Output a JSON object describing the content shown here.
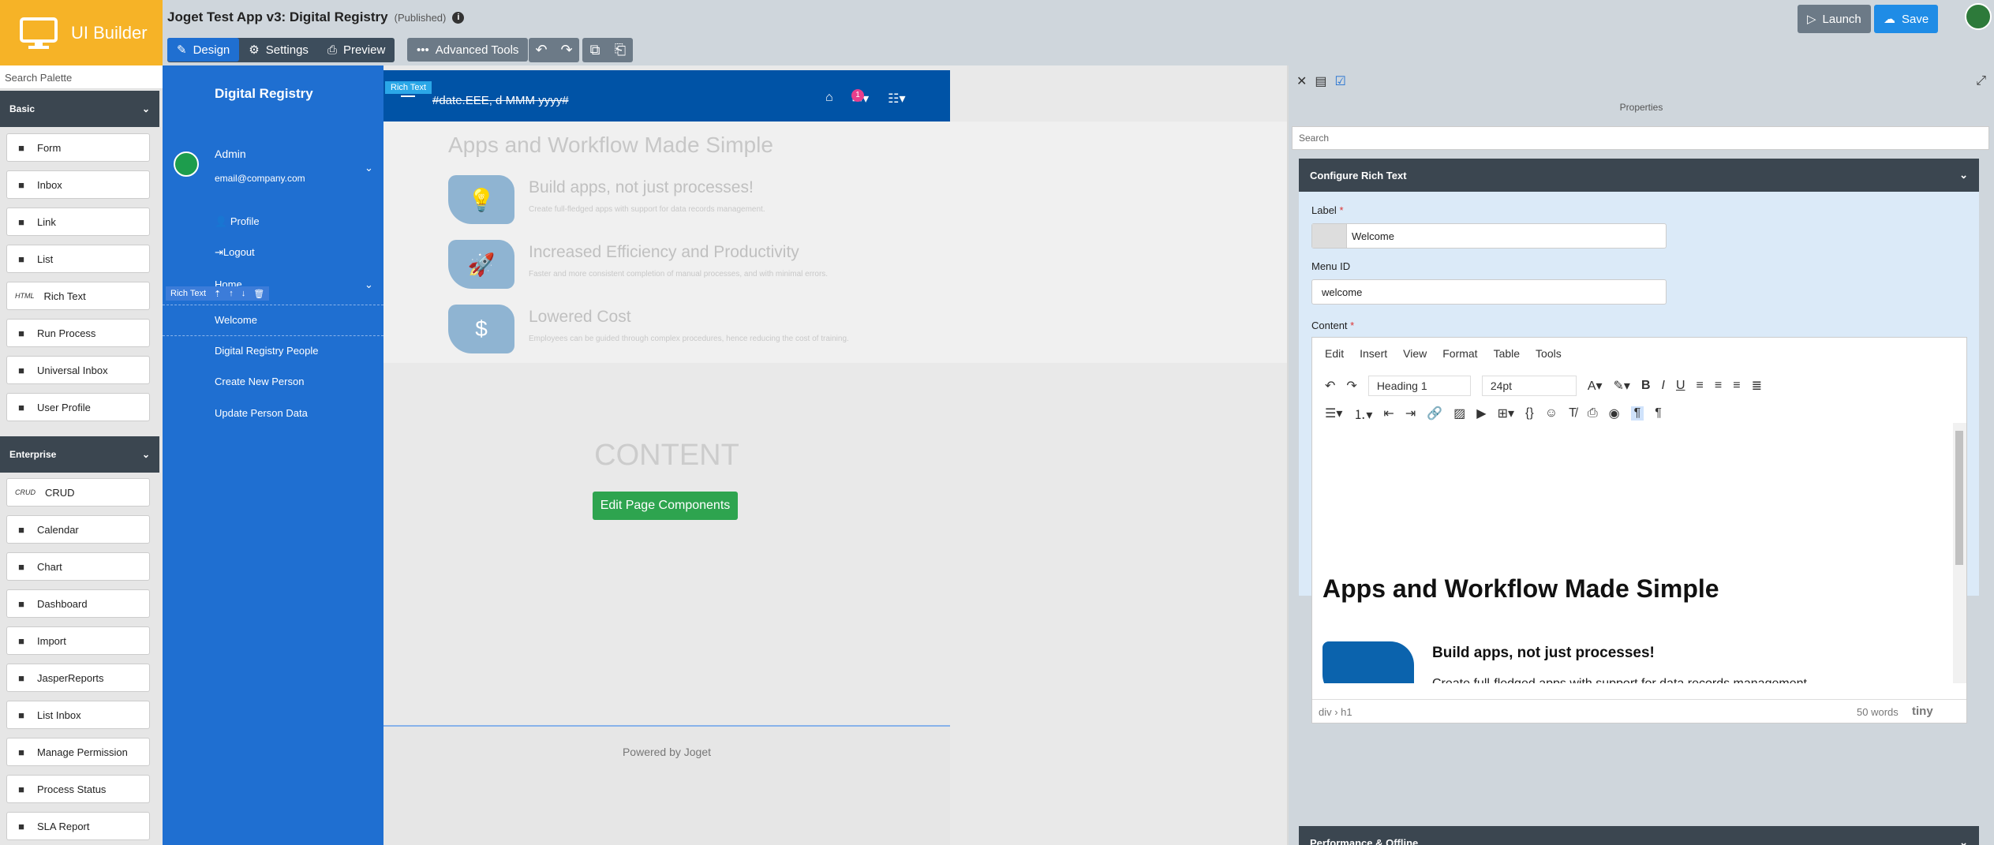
{
  "app": {
    "builder_name": "UI Builder",
    "title": "Joget Test App v3: Digital Registry",
    "status": "(Published)"
  },
  "toolbar": {
    "tabs": [
      "Design",
      "Settings",
      "Preview"
    ],
    "advanced_tools": "Advanced Tools",
    "launch": "Launch",
    "save": "Save"
  },
  "palette": {
    "search_placeholder": "Search Palette",
    "groups": [
      {
        "label": "Basic",
        "items": [
          {
            "label": "Form",
            "icon": "form-icon"
          },
          {
            "label": "Inbox",
            "icon": "inbox-icon"
          },
          {
            "label": "Link",
            "icon": "link-icon"
          },
          {
            "label": "List",
            "icon": "list-icon"
          },
          {
            "label": "Rich Text",
            "icon": "html-icon",
            "icon_text": "HTML"
          },
          {
            "label": "Run Process",
            "icon": "play-icon"
          },
          {
            "label": "Universal Inbox",
            "icon": "inbox-icon"
          },
          {
            "label": "User Profile",
            "icon": "user-edit-icon"
          }
        ]
      },
      {
        "label": "Enterprise",
        "items": [
          {
            "label": "CRUD",
            "icon": "crud-icon",
            "icon_text": "CRUD"
          },
          {
            "label": "Calendar",
            "icon": "calendar-icon"
          },
          {
            "label": "Chart",
            "icon": "chart-icon"
          },
          {
            "label": "Dashboard",
            "icon": "dashboard-icon"
          },
          {
            "label": "Import",
            "icon": "import-icon"
          },
          {
            "label": "JasperReports",
            "icon": "report-icon"
          },
          {
            "label": "List Inbox",
            "icon": "inbox-icon"
          },
          {
            "label": "Manage Permission",
            "icon": "users-icon"
          },
          {
            "label": "Process Status",
            "icon": "status-icon"
          },
          {
            "label": "SLA Report",
            "icon": "report-icon"
          }
        ]
      }
    ]
  },
  "canvas": {
    "nav": {
      "brand": "Digital Registry",
      "user_name": "Admin",
      "user_email": "email@company.com",
      "profile": "Profile",
      "logout": "Logout",
      "home": "Home",
      "element_bar_label": "Rich Text",
      "menu_items": [
        "Welcome",
        "Digital Registry People",
        "Create New Person",
        "Update Person Data"
      ]
    },
    "header": {
      "selected_label": "Rich Text",
      "date_format": "#date.EEE, d MMM yyyy#",
      "badge_count": "1"
    },
    "hero": {
      "title": "Apps and Workflow Made Simple",
      "features": [
        {
          "title": "Build apps, not just processes!",
          "desc": "Create full-fledged apps with support for data records management.",
          "icon": "lightbulb-icon"
        },
        {
          "title": "Increased Efficiency and Productivity",
          "desc": "Faster and more consistent completion of manual processes, and with minimal errors.",
          "icon": "rocket-icon"
        },
        {
          "title": "Lowered Cost",
          "desc": "Employees can be guided through complex procedures, hence reducing the cost of training.",
          "icon": "dollar-icon"
        }
      ]
    },
    "content_label": "CONTENT",
    "edit_button": "Edit Page Components",
    "footer": "Powered by Joget"
  },
  "properties": {
    "title": "Properties",
    "search_placeholder": "Search",
    "section_title": "Configure Rich Text",
    "label_field": {
      "label": "Label",
      "value": "Welcome"
    },
    "menu_id_field": {
      "label": "Menu ID",
      "value": "welcome"
    },
    "content_label": "Content",
    "editor": {
      "menu": [
        "Edit",
        "Insert",
        "View",
        "Format",
        "Table",
        "Tools"
      ],
      "block_format": "Heading 1",
      "font_size": "24pt",
      "doc_heading": "Apps and Workflow Made Simple",
      "doc_feature_title": "Build apps, not just processes!",
      "doc_feature_desc": "Create full-fledged apps with support for data records management.",
      "path": "div › h1",
      "word_count": "50 words",
      "brand": "tiny"
    },
    "performance_section": "Performance & Offline"
  },
  "colors": {
    "logo_bg": "#f6b327",
    "primary": "#1f6fd1",
    "header_bg": "#0053a6",
    "dark_bar": "#3b4650",
    "edit_button": "#2ea44f"
  }
}
